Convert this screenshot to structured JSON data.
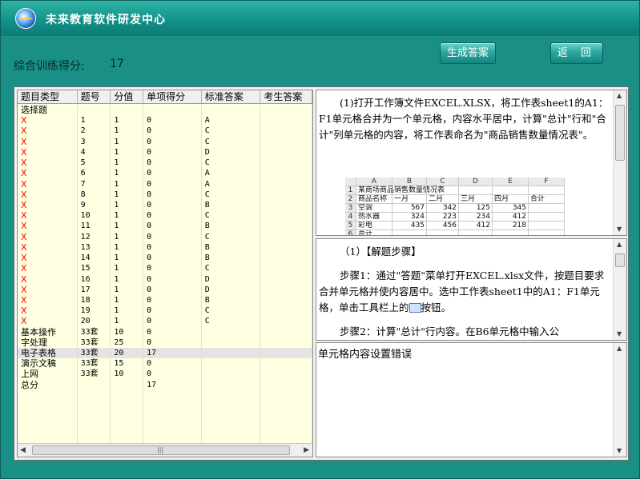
{
  "app": {
    "title": "未来教育软件研发中心"
  },
  "score": {
    "label": "综合训练得分:",
    "value": "17"
  },
  "buttons": {
    "generate": "生成答案",
    "back": "返 回"
  },
  "table": {
    "headers": [
      "题目类型",
      "题号",
      "分值",
      "单项得分",
      "标准答案",
      "考生答案"
    ],
    "rows": [
      {
        "type": "选择题",
        "num": "",
        "score": "",
        "item": "",
        "std": "",
        "mark": false
      },
      {
        "type": "X",
        "num": "1",
        "score": "1",
        "item": "0",
        "std": "A",
        "mark": true
      },
      {
        "type": "X",
        "num": "2",
        "score": "1",
        "item": "0",
        "std": "C",
        "mark": true
      },
      {
        "type": "X",
        "num": "3",
        "score": "1",
        "item": "0",
        "std": "C",
        "mark": true
      },
      {
        "type": "X",
        "num": "4",
        "score": "1",
        "item": "0",
        "std": "D",
        "mark": true
      },
      {
        "type": "X",
        "num": "5",
        "score": "1",
        "item": "0",
        "std": "C",
        "mark": true
      },
      {
        "type": "X",
        "num": "6",
        "score": "1",
        "item": "0",
        "std": "A",
        "mark": true
      },
      {
        "type": "X",
        "num": "7",
        "score": "1",
        "item": "0",
        "std": "A",
        "mark": true
      },
      {
        "type": "X",
        "num": "8",
        "score": "1",
        "item": "0",
        "std": "C",
        "mark": true
      },
      {
        "type": "X",
        "num": "9",
        "score": "1",
        "item": "0",
        "std": "B",
        "mark": true
      },
      {
        "type": "X",
        "num": "10",
        "score": "1",
        "item": "0",
        "std": "C",
        "mark": true
      },
      {
        "type": "X",
        "num": "11",
        "score": "1",
        "item": "0",
        "std": "B",
        "mark": true
      },
      {
        "type": "X",
        "num": "12",
        "score": "1",
        "item": "0",
        "std": "C",
        "mark": true
      },
      {
        "type": "X",
        "num": "13",
        "score": "1",
        "item": "0",
        "std": "B",
        "mark": true
      },
      {
        "type": "X",
        "num": "14",
        "score": "1",
        "item": "0",
        "std": "B",
        "mark": true
      },
      {
        "type": "X",
        "num": "15",
        "score": "1",
        "item": "0",
        "std": "C",
        "mark": true
      },
      {
        "type": "X",
        "num": "16",
        "score": "1",
        "item": "0",
        "std": "D",
        "mark": true
      },
      {
        "type": "X",
        "num": "17",
        "score": "1",
        "item": "0",
        "std": "D",
        "mark": true
      },
      {
        "type": "X",
        "num": "18",
        "score": "1",
        "item": "0",
        "std": "B",
        "mark": true
      },
      {
        "type": "X",
        "num": "19",
        "score": "1",
        "item": "0",
        "std": "C",
        "mark": true
      },
      {
        "type": "X",
        "num": "20",
        "score": "1",
        "item": "0",
        "std": "C",
        "mark": true
      },
      {
        "type": "基本操作",
        "num": "33套",
        "score": "10",
        "item": "0",
        "std": "",
        "mark": false
      },
      {
        "type": "字处理",
        "num": "33套",
        "score": "25",
        "item": "0",
        "std": "",
        "mark": false
      },
      {
        "type": "电子表格",
        "num": "33套",
        "score": "20",
        "item": "17",
        "std": "",
        "mark": false,
        "selected": true
      },
      {
        "type": "演示文稿",
        "num": "33套",
        "score": "15",
        "item": "0",
        "std": "",
        "mark": false
      },
      {
        "type": "上网",
        "num": "33套",
        "score": "10",
        "item": "0",
        "std": "",
        "mark": false
      },
      {
        "type": "总分",
        "num": "",
        "score": "",
        "item": "17",
        "std": "",
        "mark": false
      }
    ]
  },
  "question": {
    "text": "(1)打开工作簿文件EXCEL.XLSX，将工作表sheet1的A1：F1单元格合并为一个单元格，内容水平居中，计算\"总计\"行和\"合计\"列单元格的内容，将工作表命名为\"商品销售数量情况表\"。"
  },
  "excel": {
    "col_headers": [
      "",
      "A",
      "B",
      "C",
      "D",
      "E",
      "F"
    ],
    "rows": [
      [
        "1",
        "某商场商品销售数量情况表",
        "",
        "",
        "",
        "",
        ""
      ],
      [
        "2",
        "商品名称",
        "一月",
        "二月",
        "三月",
        "四月",
        "合计"
      ],
      [
        "3",
        "空调",
        "567",
        "342",
        "125",
        "345",
        ""
      ],
      [
        "4",
        "热水器",
        "324",
        "223",
        "234",
        "412",
        ""
      ],
      [
        "5",
        "彩电",
        "435",
        "456",
        "412",
        "218",
        ""
      ],
      [
        "6",
        "总计",
        "",
        "",
        "",
        "",
        ""
      ]
    ]
  },
  "solution": {
    "heading": "（1）【解题步骤】",
    "step1_a": "步骤1：通过\"答题\"菜单打开EXCEL.xlsx文件，按题目要求合并单元格并使内容居中。选中工作表sheet1中的A1：F1单元格，单击工具栏上的",
    "step1_b": "按钮。",
    "step2": "步骤2：计算\"总计\"行内容。在B6单元格中输入公"
  },
  "result": {
    "text": "单元格内容设置错误"
  },
  "colors": {
    "titlebar": "#13928a",
    "wrong_mark": "#ff0000",
    "table_bg": "#ffffe1"
  },
  "icons": {
    "logo": "app-logo-icon",
    "merge": "merge-center-icon"
  }
}
